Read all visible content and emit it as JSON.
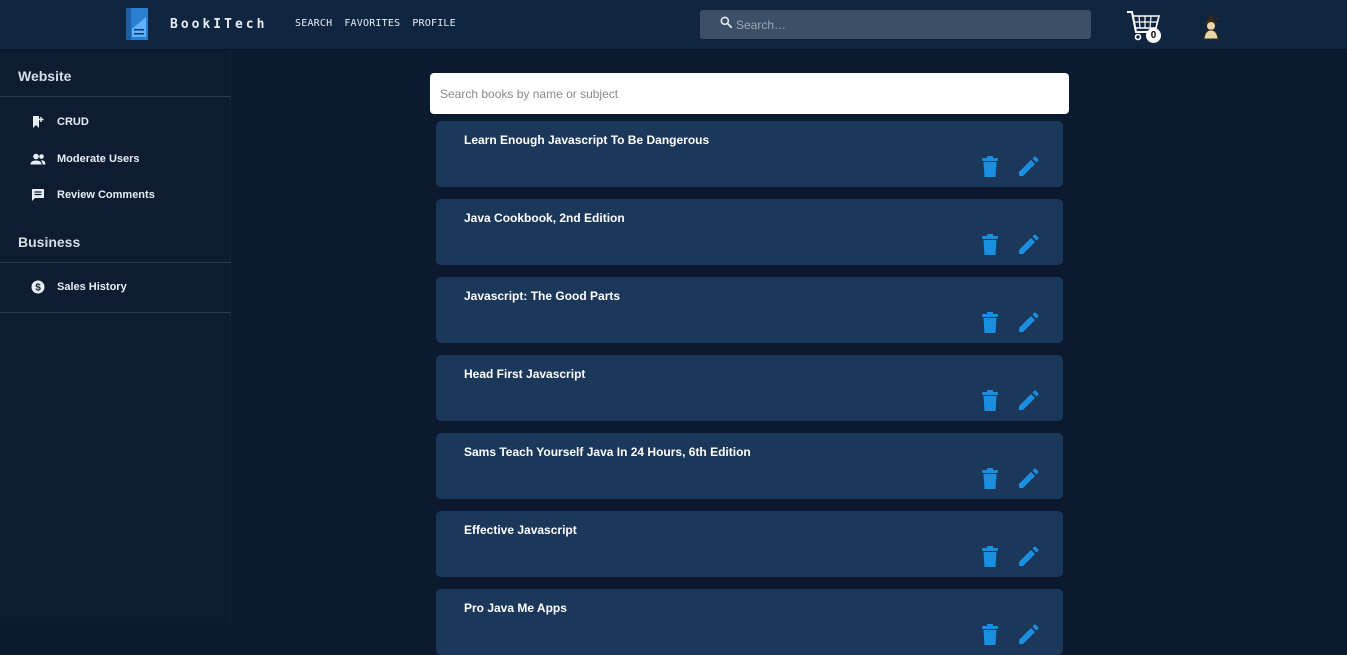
{
  "navbar": {
    "brand": "BookITech",
    "links": [
      {
        "label": "SEARCH"
      },
      {
        "label": "FAVORITES"
      },
      {
        "label": "PROFILE"
      }
    ],
    "search_placeholder": "Search…",
    "cart_count": "0",
    "icons": {
      "search": "search-icon",
      "cart": "cart-icon",
      "avatar": "avatar-icon",
      "logo": "logo-icon"
    }
  },
  "sidebar": {
    "sections": [
      {
        "title": "Website",
        "items": [
          {
            "label": "CRUD",
            "icon": "bookmark-plus-icon"
          },
          {
            "label": "Moderate Users",
            "icon": "people-icon"
          },
          {
            "label": "Review Comments",
            "icon": "comment-icon"
          }
        ]
      },
      {
        "title": "Business",
        "items": [
          {
            "label": "Sales History",
            "icon": "dollar-icon"
          }
        ]
      }
    ]
  },
  "main": {
    "search_placeholder": "Search books by name or subject",
    "books": [
      {
        "title": "Learn Enough Javascript To Be Dangerous"
      },
      {
        "title": "Java Cookbook, 2nd Edition"
      },
      {
        "title": "Javascript: The Good Parts"
      },
      {
        "title": "Head First Javascript"
      },
      {
        "title": "Sams Teach Yourself Java In 24 Hours, 6th Edition"
      },
      {
        "title": "Effective Javascript"
      },
      {
        "title": "Pro Java Me Apps"
      }
    ]
  },
  "colors": {
    "background": "#0b1a2e",
    "navbar": "#102540",
    "card": "#1b375a",
    "action_blue": "#1a8fe0"
  }
}
